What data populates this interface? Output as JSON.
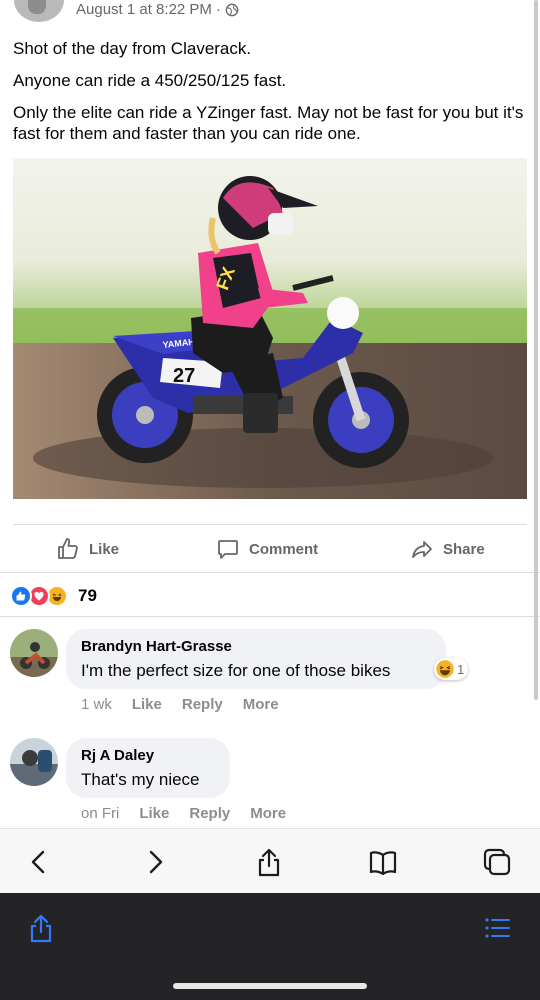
{
  "post": {
    "timestamp": "August 1 at 8:22 PM",
    "separator": "·",
    "paragraphs": [
      "Shot of the day from Claverack.",
      "Anyone can ride a 450/250/125 fast.",
      "Only the elite can ride a YZinger fast. May not be fast for you but it's fast for them and faster than you can ride one."
    ],
    "photo": {
      "brand_text": "YAMAHA",
      "number_plate": "27",
      "jersey_text": "FX"
    }
  },
  "actions": {
    "like": "Like",
    "comment": "Comment",
    "share": "Share"
  },
  "reactions": {
    "count": "79"
  },
  "comments": [
    {
      "author": "Brandyn Hart-Grasse",
      "text": "I'm the perfect size for one of those bikes",
      "reaction_count": "1",
      "time": "1 wk",
      "like": "Like",
      "reply": "Reply",
      "more": "More"
    },
    {
      "author": "Rj A Daley",
      "text": "That's my niece",
      "time": "on Fri",
      "like": "Like",
      "reply": "Reply",
      "more": "More"
    }
  ],
  "colors": {
    "accent": "#1877f2",
    "secondary_text": "#65676b",
    "bubble": "#f0f2f5",
    "toolbar": "#242426",
    "toolbar_icon": "#3478f6"
  },
  "icons": {
    "browser_nav": [
      "back-icon",
      "forward-icon",
      "share-icon",
      "bookmarks-icon",
      "tabs-icon"
    ],
    "toolbar": [
      "share-icon",
      "list-icon"
    ]
  }
}
